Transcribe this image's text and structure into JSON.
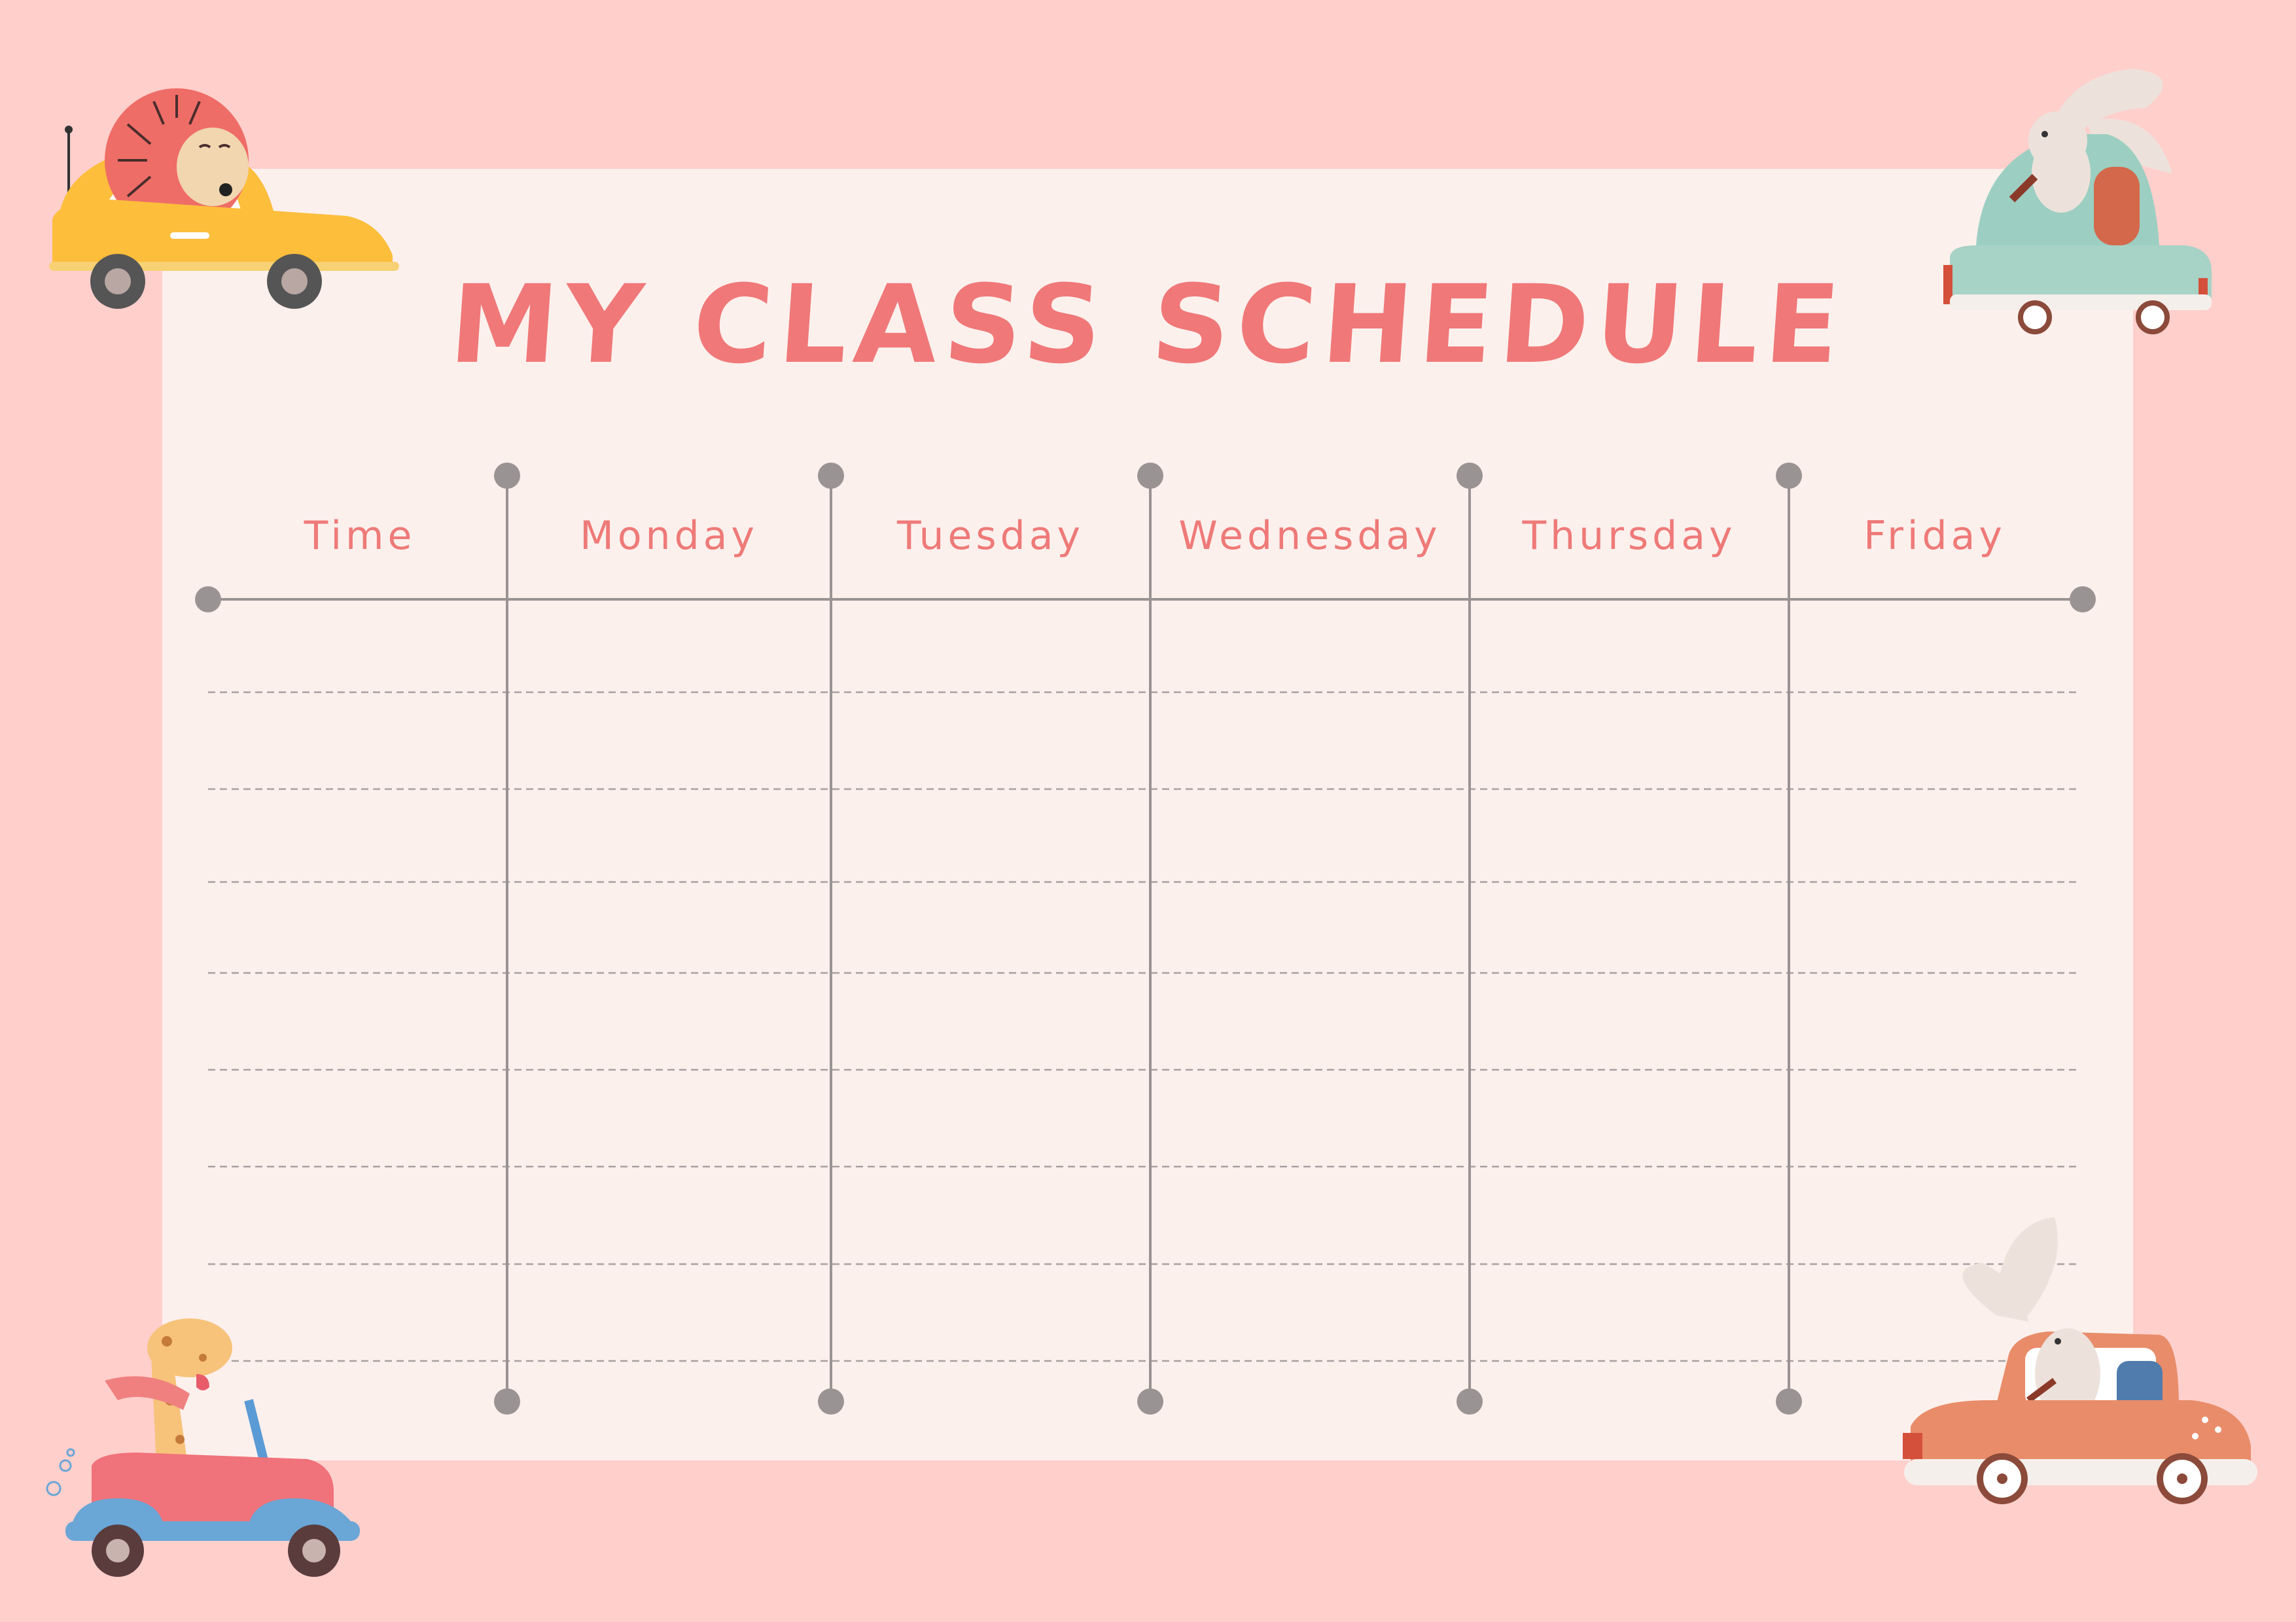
{
  "title": "MY CLASS SCHEDULE",
  "headers": [
    "Time",
    "Monday",
    "Tuesday",
    "Wednesday",
    "Thursday",
    "Friday"
  ],
  "rows": 8,
  "colors": {
    "background": "#FFCFCC",
    "sheet": "#FCF0ED",
    "title": "#F07878",
    "header_text": "#EE7A78",
    "lines": "#9A9393"
  },
  "decorations": [
    "lion-car-icon",
    "rabbit-car-icon",
    "giraffe-car-icon",
    "bunny-car-icon"
  ]
}
